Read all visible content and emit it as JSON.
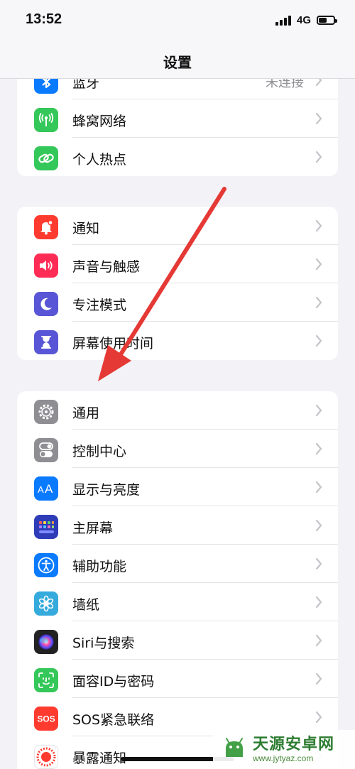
{
  "status_bar": {
    "time": "13:52",
    "network": "4G",
    "battery_level": 0.55
  },
  "nav": {
    "title": "设置"
  },
  "groups": [
    {
      "items": [
        {
          "label": "蓝牙",
          "value": "未连接",
          "icon": "bluetooth-icon",
          "color": "#0a7aff"
        },
        {
          "label": "蜂窝网络",
          "icon": "antenna-icon",
          "color": "#34c759"
        },
        {
          "label": "个人热点",
          "icon": "hotspot-link-icon",
          "color": "#34c759"
        }
      ]
    },
    {
      "items": [
        {
          "label": "通知",
          "icon": "bell-icon",
          "color": "#ff3b30"
        },
        {
          "label": "声音与触感",
          "icon": "speaker-icon",
          "color": "#ff2d55"
        },
        {
          "label": "专注模式",
          "icon": "moon-icon",
          "color": "#5856d6"
        },
        {
          "label": "屏幕使用时间",
          "icon": "hourglass-icon",
          "color": "#5856d6"
        }
      ]
    },
    {
      "items": [
        {
          "label": "通用",
          "icon": "gear-icon",
          "color": "#8e8e93"
        },
        {
          "label": "控制中心",
          "icon": "toggles-icon",
          "color": "#8e8e93"
        },
        {
          "label": "显示与亮度",
          "icon": "text-size-icon",
          "color": "#0a7aff"
        },
        {
          "label": "主屏幕",
          "icon": "app-grid-icon",
          "color": "#2f3cb8"
        },
        {
          "label": "辅助功能",
          "icon": "accessibility-icon",
          "color": "#0a7aff"
        },
        {
          "label": "墙纸",
          "icon": "flower-icon",
          "color": "#35aadc"
        },
        {
          "label": "Siri与搜索",
          "icon": "siri-icon",
          "color": "#222222"
        },
        {
          "label": "面容ID与密码",
          "icon": "face-id-icon",
          "color": "#34c759"
        },
        {
          "label": "SOS紧急联络",
          "icon": "sos-icon",
          "color": "#ff3b30"
        },
        {
          "label": "暴露通知",
          "icon": "exposure-icon",
          "color": "#ffffff"
        }
      ]
    }
  ],
  "watermark": {
    "name": "天源安卓网",
    "url": "www.jytyaz.com"
  },
  "colors": {
    "background": "#f2f2f7",
    "annotation_arrow": "#e53935"
  }
}
